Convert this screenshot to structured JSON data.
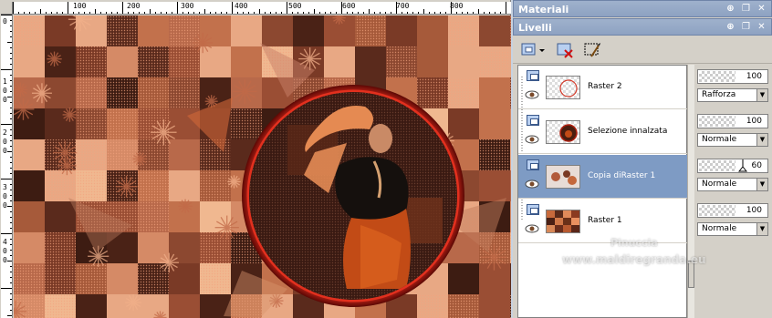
{
  "rulers": {
    "horizontal": [
      "100",
      "200",
      "300",
      "400",
      "500",
      "600",
      "700",
      "800"
    ],
    "vertical": [
      "0",
      "1",
      "0",
      "0",
      "2",
      "0",
      "0",
      "3",
      "0",
      "0",
      "4",
      "0",
      "0"
    ]
  },
  "materials_panel": {
    "title": "Materiali"
  },
  "layers_panel": {
    "title": "Livelli",
    "layers": [
      {
        "name": "Raster 2",
        "opacity": "100",
        "blend_mode": "Rafforza",
        "selected": false
      },
      {
        "name": "Selezione innalzata",
        "opacity": "100",
        "blend_mode": "Normale",
        "selected": false
      },
      {
        "name": "Copia diRaster 1",
        "opacity": "60",
        "blend_mode": "Normale",
        "selected": true
      },
      {
        "name": "Raster 1",
        "opacity": "100",
        "blend_mode": "Normale",
        "selected": false
      }
    ]
  },
  "watermark": {
    "line1": "Pinuccia",
    "line2": "www.maldiregranda.eu"
  },
  "colors": {
    "panel_title": "#8ea2c2",
    "selected_layer": "#7e9bc4",
    "accent_red": "#c81e14"
  },
  "icons": [
    "pin-icon",
    "restore-icon",
    "close-icon",
    "new-layer-icon",
    "delete-layer-icon",
    "edit-selection-icon",
    "visibility-eye-icon",
    "layer-type-icon"
  ]
}
